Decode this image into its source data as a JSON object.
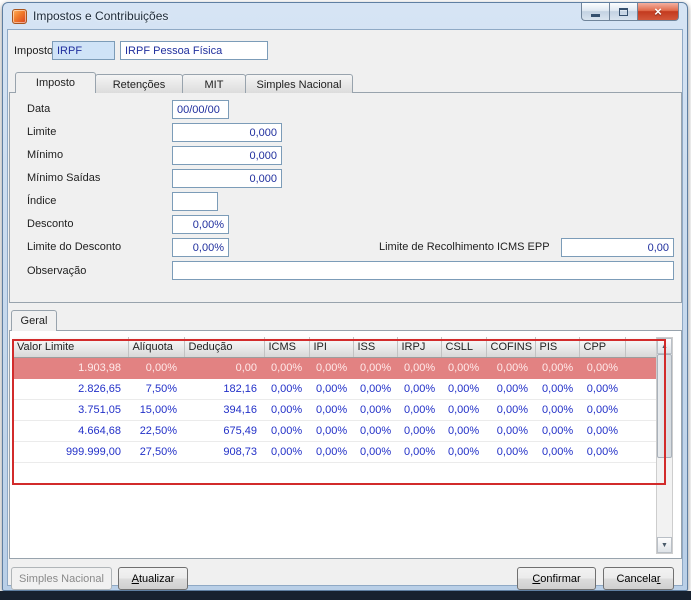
{
  "window": {
    "title": "Impostos e Contribuições"
  },
  "header": {
    "label": "Imposto",
    "code": "IRPF",
    "description": "IRPF Pessoa Física"
  },
  "tabs": [
    "Imposto",
    "Retenções",
    "MIT",
    "Simples Nacional"
  ],
  "form": {
    "data": {
      "label": "Data",
      "value": "00/00/00"
    },
    "limite": {
      "label": "Limite",
      "value": "0,000"
    },
    "minimo": {
      "label": "Mínimo",
      "value": "0,000"
    },
    "minimo_saidas": {
      "label": "Mínimo Saídas",
      "value": "0,000"
    },
    "indice": {
      "label": "Índice",
      "value": ""
    },
    "desconto": {
      "label": "Desconto",
      "value": "0,00%"
    },
    "limite_desconto": {
      "label": "Limite do Desconto",
      "value": "0,00%"
    },
    "icms_epp": {
      "label": "Limite de Recolhimento ICMS EPP",
      "value": "0,00"
    },
    "observacao": {
      "label": "Observação",
      "value": ""
    }
  },
  "geral_tab": "Geral",
  "table": {
    "columns": [
      "Valor Limite",
      "Alíquota",
      "Dedução",
      "ICMS",
      "IPI",
      "ISS",
      "IRPJ",
      "CSLL",
      "COFINS",
      "PIS",
      "CPP"
    ],
    "rows": [
      [
        "1.903,98",
        "0,00%",
        "0,00",
        "0,00%",
        "0,00%",
        "0,00%",
        "0,00%",
        "0,00%",
        "0,00%",
        "0,00%",
        "0,00%"
      ],
      [
        "2.826,65",
        "7,50%",
        "182,16",
        "0,00%",
        "0,00%",
        "0,00%",
        "0,00%",
        "0,00%",
        "0,00%",
        "0,00%",
        "0,00%"
      ],
      [
        "3.751,05",
        "15,00%",
        "394,16",
        "0,00%",
        "0,00%",
        "0,00%",
        "0,00%",
        "0,00%",
        "0,00%",
        "0,00%",
        "0,00%"
      ],
      [
        "4.664,68",
        "22,50%",
        "675,49",
        "0,00%",
        "0,00%",
        "0,00%",
        "0,00%",
        "0,00%",
        "0,00%",
        "0,00%",
        "0,00%"
      ],
      [
        "999.999,00",
        "27,50%",
        "908,73",
        "0,00%",
        "0,00%",
        "0,00%",
        "0,00%",
        "0,00%",
        "0,00%",
        "0,00%",
        "0,00%"
      ]
    ],
    "selected_row_index": 0
  },
  "buttons": {
    "simples_nacional": {
      "label": "Simples Nacional"
    },
    "atualizar": {
      "pre": "",
      "accel": "A",
      "post": "tualizar"
    },
    "confirmar": {
      "pre": "",
      "accel": "C",
      "post": "onfirmar"
    },
    "cancelar": {
      "pre": "Cancela",
      "accel": "r",
      "post": ""
    }
  },
  "icons": {
    "close": "×",
    "scroll_up": "▲",
    "scroll_down": "▼"
  },
  "colors": {
    "annotation": "#d22b2b",
    "selected_row_bg": "#e28282",
    "selected_row_text": "#ffeaea",
    "grid_text": "#2230c8",
    "input_text": "#202f9e"
  }
}
